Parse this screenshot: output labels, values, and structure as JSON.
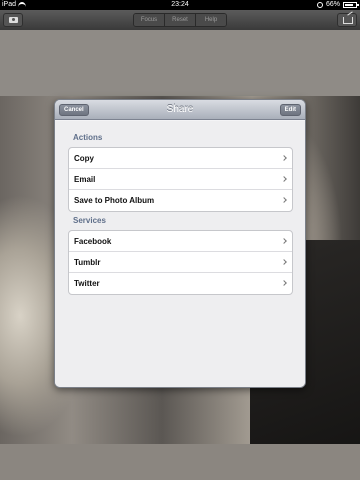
{
  "status_bar": {
    "carrier": "iPad",
    "time": "23:24",
    "battery": "66%"
  },
  "toolbar": {
    "segments": [
      "Focus",
      "Reset",
      "Help"
    ]
  },
  "share_sheet": {
    "title": "Share",
    "cancel_label": "Cancel",
    "edit_label": "Edit",
    "sections": [
      {
        "header": "Actions",
        "items": [
          "Copy",
          "Email",
          "Save to Photo Album"
        ]
      },
      {
        "header": "Services",
        "items": [
          "Facebook",
          "Tumblr",
          "Twitter"
        ]
      }
    ]
  }
}
